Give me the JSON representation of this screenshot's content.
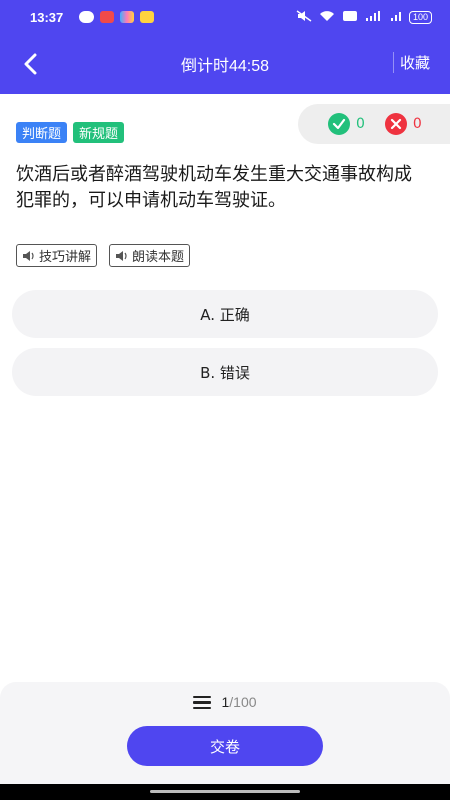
{
  "status_bar": {
    "time": "13:37",
    "battery": "100"
  },
  "nav": {
    "title": "倒计时44:58",
    "favorite_label": "收藏"
  },
  "tags": {
    "type": "判断题",
    "category": "新规题"
  },
  "score": {
    "correct": "0",
    "wrong": "0"
  },
  "question": {
    "text": "饮酒后或者醉酒驾驶机动车发生重大交通事故构成犯罪的，可以申请机动车驾驶证。"
  },
  "tools": {
    "tips": "技巧讲解",
    "read": "朗读本题"
  },
  "options": [
    {
      "label": "A. 正确"
    },
    {
      "label": "B. 错误"
    }
  ],
  "progress": {
    "current": "1",
    "total": "/100"
  },
  "submit_label": "交卷",
  "colors": {
    "primary": "#4f46f0",
    "correct": "#22c07b",
    "wrong": "#ef3340",
    "tag_blue": "#3b82f6"
  }
}
